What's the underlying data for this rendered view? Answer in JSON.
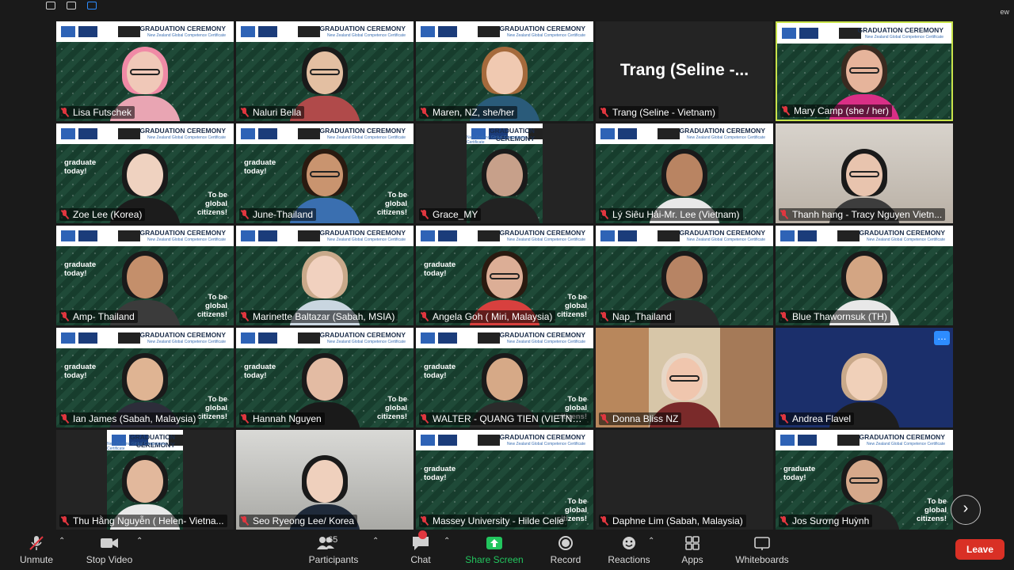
{
  "window": {
    "corner_text": "ew"
  },
  "tiles": [
    {
      "name": "Lisa Futschek",
      "bg": "green",
      "banner": true,
      "hair": "#f08aa6",
      "skin": "#f0c8b8",
      "shirt": "#e9a5b3",
      "glasses": true
    },
    {
      "name": "Naluri Bella",
      "bg": "green",
      "banner": true,
      "hair": "#1a1a1a",
      "skin": "#e3bfa2",
      "shirt": "#b04a4a",
      "glasses": true
    },
    {
      "name": "Maren, NZ, she/her",
      "bg": "green",
      "banner": true,
      "hair": "#a56a3c",
      "skin": "#f0c9b1",
      "shirt": "#2a5b7a",
      "glasses": false
    },
    {
      "name": "Trang (Seline - Vietnam)",
      "bg": "dark",
      "big_label": "Trang  (Seline -..."
    },
    {
      "name": "Mary Camp (she / her)",
      "bg": "green",
      "banner": true,
      "hair": "#3a2a20",
      "skin": "#e6b49b",
      "shirt": "#d92f86",
      "glasses": true,
      "active": true
    },
    {
      "name": "Zoe Lee (Korea)",
      "bg": "green",
      "banner": true,
      "grad": true,
      "hair": "#1a1a1a",
      "skin": "#efd2c0",
      "shirt": "#1c1c1c"
    },
    {
      "name": "June-Thailand",
      "bg": "green",
      "banner": true,
      "grad": true,
      "hair": "#2a1a10",
      "skin": "#c9946f",
      "shirt": "#3a6fb0",
      "glasses": true
    },
    {
      "name": "Grace_MY",
      "bg": "green-narrow",
      "banner": true,
      "hair": "#1a1a1a",
      "skin": "#c7a08a",
      "shirt": "#222"
    },
    {
      "name": "Lý Siêu Hải-Mr. Lee (Vietnam)",
      "bg": "green",
      "banner": true,
      "hair": "#1a1a1a",
      "skin": "#b98462",
      "shirt": "#e8e8e8"
    },
    {
      "name": "Thanh hang  - Tracy Nguyen Vietn...",
      "bg": "room",
      "hair": "#1a1a1a",
      "skin": "#e8c4ae",
      "shirt": "#3d3d3d",
      "glasses": true
    },
    {
      "name": "Amp- Thailand",
      "bg": "green",
      "banner": true,
      "grad": true,
      "hair": "#1a1a1a",
      "skin": "#c48f6b",
      "shirt": "#3b3b3b"
    },
    {
      "name": "Marinette Baltazar (Sabah, MSIA)",
      "bg": "green",
      "banner": true,
      "hair": "#c9a98a",
      "skin": "#f1d1bf",
      "shirt": "#c9d6e0"
    },
    {
      "name": "Angela Goh ( Miri, Malaysia)",
      "bg": "green",
      "banner": true,
      "grad": true,
      "hair": "#2a1a10",
      "skin": "#dcae96",
      "shirt": "#d8403e",
      "glasses": true
    },
    {
      "name": "Nap_Thailand",
      "bg": "green",
      "banner": true,
      "hair": "#1a1a1a",
      "skin": "#b78464",
      "shirt": "#2b2b2b"
    },
    {
      "name": "Blue Thawornsuk (TH)",
      "bg": "green",
      "banner": true,
      "hair": "#1a1a1a",
      "skin": "#d3a583",
      "shirt": "#e8e8e8"
    },
    {
      "name": "Ian James (Sabah, Malaysia)",
      "bg": "green",
      "banner": true,
      "grad": true,
      "hair": "#1a1a1a",
      "skin": "#dfb493",
      "shirt": "#2d2d3a"
    },
    {
      "name": "Hannah Nguyen",
      "bg": "green",
      "banner": true,
      "grad": true,
      "hair": "#1a1a1a",
      "skin": "#e3bba3",
      "shirt": "#1a1a1a"
    },
    {
      "name": "WALTER - QUANG TIEN (VIETNAM)",
      "bg": "green",
      "banner": true,
      "grad": true,
      "hair": "#1a1a1a",
      "skin": "#d6a987",
      "shirt": "#2b2b2b"
    },
    {
      "name": "Donna Bliss NZ",
      "bg": "room2",
      "hair": "#e7d7c7",
      "skin": "#f0c6ae",
      "shirt": "#7a2a2a",
      "glasses": true
    },
    {
      "name": "Andrea Flavel",
      "bg": "blue",
      "hair": "#c9a98a",
      "skin": "#f0d0b9",
      "shirt": "#1e1e1e",
      "more_button": "…"
    },
    {
      "name": "Thu Hằng Nguyễn ( Helen- Vietna...",
      "bg": "green-narrow",
      "banner": true,
      "hair": "#1a1a1a",
      "skin": "#e2b89c",
      "shirt": "#e9e9e9"
    },
    {
      "name": "Seo Ryeong Lee/ Korea",
      "bg": "gray",
      "hair": "#1a1a1a",
      "skin": "#efd0bd",
      "shirt": "#1f2a3a"
    },
    {
      "name": "Massey University - Hilde Celie",
      "bg": "green",
      "banner": true,
      "grad": true,
      "empty": true
    },
    {
      "name": "Daphne Lim (Sabah, Malaysia)",
      "bg": "dark",
      "big_label": ""
    },
    {
      "name": "Jos Sương Huỳnh",
      "bg": "green",
      "banner": true,
      "grad": true,
      "hair": "#1a1a1a",
      "skin": "#d6a98b",
      "shirt": "#222",
      "glasses": true
    }
  ],
  "overlay_text": {
    "banner_title": "GRADUATION CEREMONY",
    "banner_sub": "New Zealand Global Competence Certificate",
    "graduate_today": "graduate today!",
    "to_be_global": "To be global citizens!"
  },
  "toolbar": {
    "unmute": "Unmute",
    "stop_video": "Stop Video",
    "participants": "Participants",
    "participant_count": "65",
    "chat": "Chat",
    "share_screen": "Share Screen",
    "record": "Record",
    "reactions": "Reactions",
    "apps": "Apps",
    "whiteboards": "Whiteboards",
    "leave": "Leave"
  },
  "colors": {
    "accent_green": "#22c55e",
    "leave_red": "#d93025",
    "active_border": "#c8e34a"
  }
}
